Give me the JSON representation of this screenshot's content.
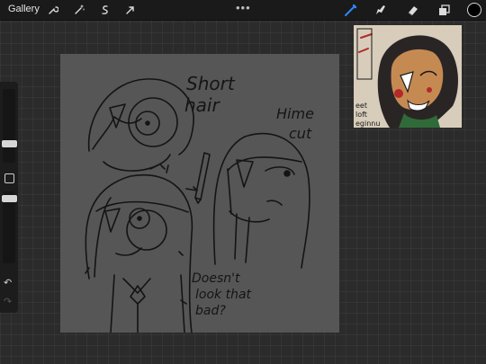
{
  "topbar": {
    "gallery_label": "Gallery",
    "left_tools": [
      "wrench-icon",
      "magic-wand-icon",
      "selection-icon",
      "transform-arrow-icon"
    ],
    "more_label": "•••",
    "right_tools": [
      "brush-icon",
      "smudge-icon",
      "eraser-icon",
      "layers-icon"
    ],
    "active_tool": "brush-icon",
    "current_color": "#000000"
  },
  "sidebar": {
    "undo_label": "↶",
    "redo_label": "↷"
  },
  "canvas": {
    "background": "#565656",
    "annotations": {
      "short_hair": [
        "Short",
        "hair"
      ],
      "hime_cut": [
        "Hime",
        "cut"
      ],
      "doesnt_look": [
        "Doesn't",
        "look that",
        "bad?"
      ]
    }
  },
  "reference": {
    "text_lines": [
      "eet",
      "loft",
      "eginnu"
    ]
  }
}
